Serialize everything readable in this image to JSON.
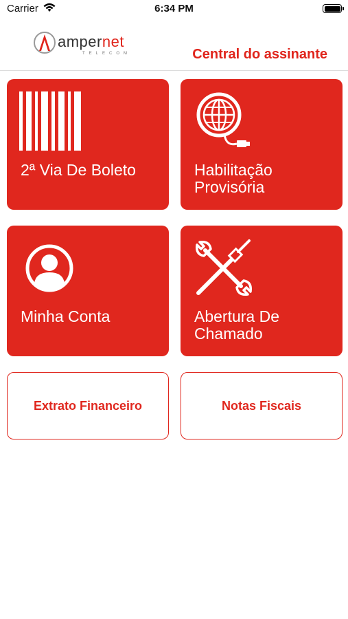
{
  "status_bar": {
    "carrier": "Carrier",
    "time": "6:34 PM"
  },
  "header": {
    "logo_amper": "amper",
    "logo_net": "net",
    "logo_sub": "TELECOM",
    "title": "Central do assinante"
  },
  "tiles": [
    {
      "label_line1": "2ª Via De Boleto",
      "label_line2": "",
      "icon": "barcode-icon"
    },
    {
      "label_line1": "Habilitação",
      "label_line2": "Provisória",
      "icon": "globe-cable-icon"
    },
    {
      "label_line1": "Minha Conta",
      "label_line2": "",
      "icon": "user-icon"
    },
    {
      "label_line1": "Abertura De",
      "label_line2": "Chamado",
      "icon": "tools-icon"
    }
  ],
  "buttons": [
    {
      "label": "Extrato Financeiro"
    },
    {
      "label": "Notas Fiscais"
    }
  ],
  "colors": {
    "accent": "#e0271e",
    "background": "#ffffff"
  }
}
